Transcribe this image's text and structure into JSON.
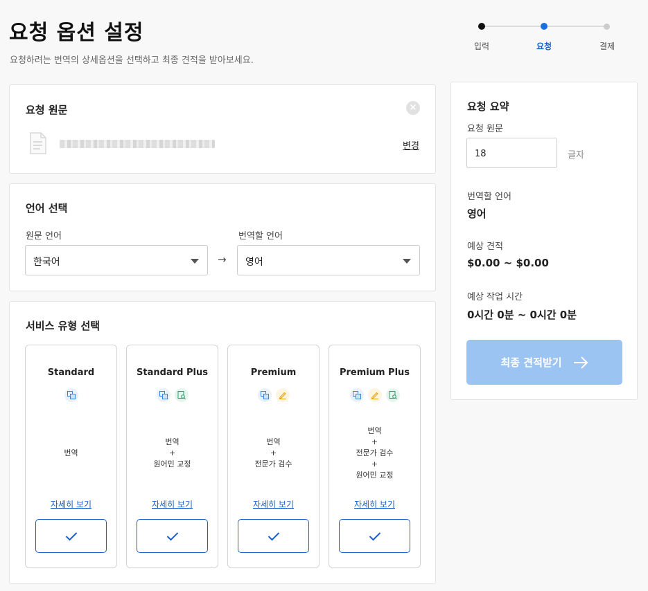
{
  "header": {
    "title": "요청 옵션 설정",
    "subtitle": "요청하려는 번역의 상세옵션을 선택하고 최종 견적을 받아보세요."
  },
  "stepper": {
    "steps": [
      {
        "label": "입력",
        "state": "done"
      },
      {
        "label": "요청",
        "state": "current"
      },
      {
        "label": "결제",
        "state": "todo"
      }
    ],
    "colors": {
      "done": "#111111",
      "current": "#1a6fe0",
      "todo": "#cccccc"
    }
  },
  "source": {
    "title": "요청 원문",
    "change_label": "변경",
    "file_icon": "document-icon",
    "close_icon": "close-icon"
  },
  "language": {
    "title": "언어 선택",
    "source_label": "원문 언어",
    "source_value": "한국어",
    "target_label": "번역할 언어",
    "target_value": "영어",
    "arrow": "→"
  },
  "service": {
    "title": "서비스 유형 선택",
    "detail_label": "자세히 보기",
    "tiles": [
      {
        "name": "Standard",
        "icons": [
          "translate-icon"
        ],
        "desc": [
          "번역"
        ]
      },
      {
        "name": "Standard Plus",
        "icons": [
          "translate-icon",
          "review-icon"
        ],
        "desc": [
          "번역",
          "+",
          "원어민 교정"
        ]
      },
      {
        "name": "Premium",
        "icons": [
          "translate-icon",
          "edit-icon"
        ],
        "desc": [
          "번역",
          "+",
          "전문가 검수"
        ]
      },
      {
        "name": "Premium Plus",
        "icons": [
          "translate-icon",
          "edit-icon",
          "review-icon"
        ],
        "desc": [
          "번역",
          "+",
          "전문가 검수",
          "+",
          "원어민 교정"
        ]
      }
    ]
  },
  "summary": {
    "title": "요청 요약",
    "source_label": "요청 원문",
    "char_count": "18",
    "char_unit": "글자",
    "target_label": "번역할 언어",
    "target_value": "영어",
    "estimate_label": "예상 견적",
    "estimate_value": "$0.00 ~ $0.00",
    "time_label": "예상 작업 시간",
    "time_value": "0시간 0분 ~ 0시간 0분",
    "button_label": "최종 견적받기"
  },
  "colors": {
    "accent": "#1a5fc9",
    "button_disabled": "#9cc4f2"
  }
}
